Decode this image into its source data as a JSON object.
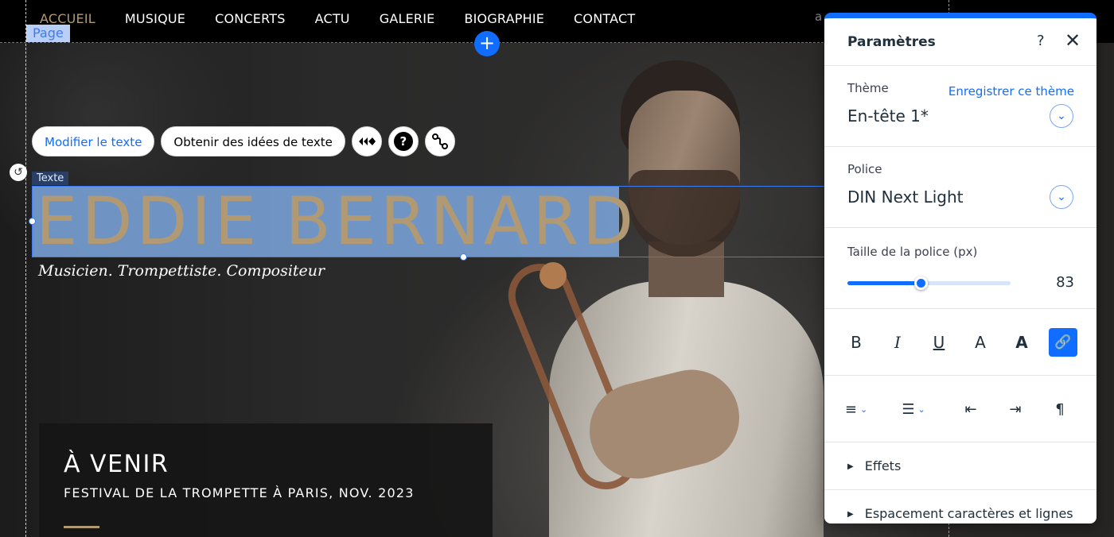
{
  "nav": {
    "items": [
      {
        "label": "ACCUEIL",
        "active": true
      },
      {
        "label": "MUSIQUE"
      },
      {
        "label": "CONCERTS"
      },
      {
        "label": "ACTU"
      },
      {
        "label": "GALERIE"
      },
      {
        "label": "BIOGRAPHIE"
      },
      {
        "label": "CONTACT"
      }
    ]
  },
  "editor": {
    "page_tag": "Page",
    "text_tag": "Texte",
    "add_section_icon": "+",
    "toolbar": {
      "edit_text": "Modifier le texte",
      "text_ideas": "Obtenir des idées de texte",
      "icons": [
        "animation-icon",
        "help-icon",
        "connect-icon"
      ]
    }
  },
  "hero": {
    "headline": "EDDIE BERNARD",
    "subtitle": "Musicien. Trompettiste. Compositeur"
  },
  "upcoming": {
    "title": "À VENIR",
    "event": "FESTIVAL DE LA TROMPETTE À PARIS, NOV. 2023"
  },
  "panel": {
    "title": "Paramètres",
    "help": "?",
    "close": "✕",
    "theme": {
      "label": "Thème",
      "value": "En-tête 1*",
      "save_link": "Enregistrer ce thème"
    },
    "font": {
      "label": "Police",
      "value": "DIN Next Light"
    },
    "size": {
      "label": "Taille de la police (px)",
      "value": "83",
      "fraction": 0.45
    },
    "format_buttons": [
      {
        "glyph": "B",
        "name": "bold-button"
      },
      {
        "glyph": "I",
        "name": "italic-button"
      },
      {
        "glyph": "U",
        "name": "underline-button"
      },
      {
        "glyph": "A",
        "name": "text-color-button"
      },
      {
        "glyph": "A",
        "name": "highlight-color-button"
      },
      {
        "glyph": "🔗",
        "name": "link-button",
        "active": true
      }
    ],
    "effects": "Effets",
    "spacing": "Espacement caractères et lignes"
  },
  "colors": {
    "accent": "#116dff",
    "gold": "#b19a73"
  }
}
